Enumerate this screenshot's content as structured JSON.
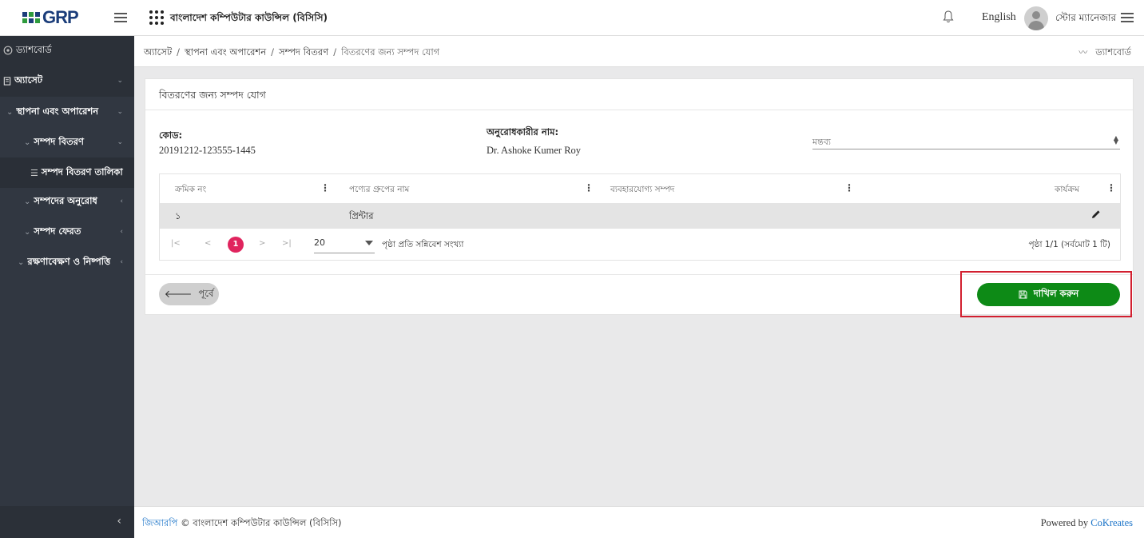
{
  "header": {
    "logo_text": "GRP",
    "app_title": "বাংলাদেশ কম্পিউটার কাউন্সিল (বিসিসি)",
    "language": "English",
    "user_name": "স্টোর ম্যানেজার"
  },
  "sidebar": {
    "items": [
      {
        "label": "ড্যাশবোর্ড"
      },
      {
        "label": "অ্যাসেট"
      },
      {
        "label": "স্থাপনা এবং অপারেশন"
      },
      {
        "label": "সম্পদ বিতরণ"
      },
      {
        "label": "সম্পদ বিতরণ তালিকা"
      },
      {
        "label": "সম্পদের অনুরোধ"
      },
      {
        "label": "সম্পদ ফেরত"
      },
      {
        "label": "রক্ষণাবেক্ষণ ও নিষ্পত্তি"
      }
    ]
  },
  "breadcrumb": {
    "items": [
      "অ্যাসেট",
      "স্থাপনা এবং অপারেশন",
      "সম্পদ বিতরণ",
      "বিতরণের জন্য সম্পদ যোগ"
    ],
    "dashboard_link": "ড্যাশবোর্ড"
  },
  "card": {
    "title": "বিতরণের জন্য সম্পদ যোগ",
    "code_label": "কোড:",
    "code_value": "20191212-123555-1445",
    "requester_label": "অনুরোধকারীর নাম:",
    "requester_value": "Dr. Ashoke Kumer Roy",
    "remark_placeholder": "মন্তব্য"
  },
  "table": {
    "columns": [
      "ক্রমিক নং",
      "পণ্যের গ্রুপের নাম",
      "ব্যবহারযোগ্য সম্পদ",
      "কার্যক্রম"
    ],
    "rows": [
      {
        "serial": "১",
        "group": "প্রিন্টার",
        "usable": ""
      }
    ]
  },
  "pagination": {
    "first": "|<",
    "prev": "<",
    "current_page": "1",
    "next": ">",
    "last": ">|",
    "page_size": "20",
    "page_size_label": "পৃষ্ঠা প্রতি সন্নিবেশ সংখ্যা",
    "page_info": "পৃষ্ঠা 1/1 (সর্বমোট 1 টি)"
  },
  "buttons": {
    "back": "পূর্বে",
    "submit": "দাখিল করুন"
  },
  "footer": {
    "brand": "জিআরপি",
    "copyright": " © বাংলাদেশ কম্পিউটার কাউন্সিল (বিসিসি)",
    "powered_by": "Powered by ",
    "vendor": "CoKreates"
  },
  "colors": {
    "sidebar_bg": "#313741",
    "submit_green": "#0d8a16",
    "active_page": "#e0245e",
    "highlight_red": "#d21f2f",
    "link_blue": "#1a73c8"
  }
}
